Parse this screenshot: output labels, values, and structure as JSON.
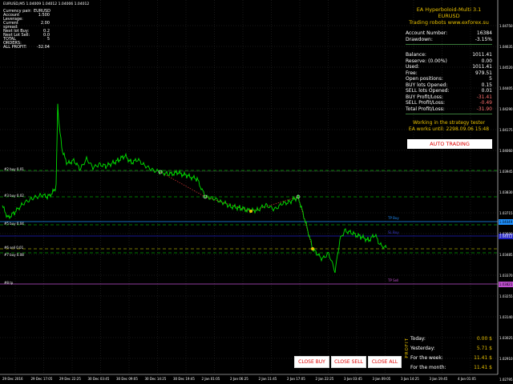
{
  "header": {
    "symbol": "EURUSD,M5",
    "ohlc": "1.04009 1.04012 1.04006 1.04012"
  },
  "info": [
    {
      "label": "Currency pair",
      "value": "EURUSD"
    },
    {
      "label": "Account Leverage",
      "value": "1:500"
    },
    {
      "label": "Current spread",
      "value": "2.00"
    },
    {
      "label": "Next lot Buy",
      "value": "0.2"
    },
    {
      "label": "Next Lot Sell",
      "value": "0.0"
    },
    {
      "label": "TOTAL ORDERS",
      "value": "5"
    },
    {
      "label": "ALL PROFIT",
      "value": "-32.04"
    }
  ],
  "panel": {
    "ea_title": "EA Hyperboloid-Multi 3.1 EURUSD",
    "ea_site": "Trading robots www.exforex.su",
    "account_number_label": "Account Number:",
    "account_number": "16384",
    "drawdown_label": "Drawdown:",
    "drawdown": "-3.15%",
    "balance_label": "Balance:",
    "balance": "1011.41",
    "reserve_label": "Reserve: (0.00%)",
    "reserve": "0.00",
    "used_label": "Used:",
    "used": "1011.41",
    "free_label": "Free:",
    "free": "979.51",
    "open_positions_label": "Open positions:",
    "open_positions": "5",
    "buy_lots_label": "BUY lots Opened:",
    "buy_lots": "0.15",
    "sell_lots_label": "SELL lots Opened:",
    "sell_lots": "0.01",
    "buy_pl_label": "BUY Profit/Loss:",
    "buy_pl": "-31.41",
    "sell_pl_label": "SELL Profit/Loss:",
    "sell_pl": "-0.49",
    "total_pl_label": "Total Profit/Loss:",
    "total_pl": "-31.90",
    "status_1": "Working in the strategy tester",
    "status_2": "EA works until: 2298.09.06 15:48"
  },
  "buttons": {
    "auto_trading": "AUTO TRADING",
    "close_buy": "CLOSE BUY",
    "close_sell": "CLOSE SELL",
    "close_all": "CLOSE ALL"
  },
  "profit": {
    "vertical_label": "PROFIT",
    "today_label": "Today:",
    "today": "0.00 $",
    "yesterday_label": "Yesterday:",
    "yesterday": "5.71 $",
    "week_label": "For the week:",
    "week": "11.41 $",
    "month_label": "For the month:",
    "month": "11.41 $"
  },
  "line_labels": {
    "buy2": "#2 buy 0.01",
    "buy3": "#3 buy 0.02",
    "buy5": "#5 buy 0.04",
    "sell6": "#6 sell 0.01",
    "buy7": "#7 buy 0.08",
    "tp": "#8 tp",
    "tp_buy": "TP Buy",
    "sl_buy": "SL Buy",
    "tp_sell": "TP Sell"
  },
  "price_tags": {
    "tp_buy": "1.04049",
    "bid": "1.04012",
    "tp_sell": "1.03821"
  },
  "price_axis": [
    "1.04750",
    "1.04635",
    "1.04520",
    "1.04405",
    "1.04290",
    "1.04175",
    "1.04060",
    "1.03945",
    "1.03830",
    "1.03715",
    "1.03600",
    "1.03485",
    "1.03370",
    "1.03255",
    "1.03140",
    "1.03025",
    "1.02910",
    "1.02795"
  ],
  "time_axis": [
    "29 Dec 2016",
    "29 Dec 17:05",
    "29 Dec 22:25",
    "30 Dec 03:45",
    "30 Dec 09:05",
    "30 Dec 14:25",
    "30 Dec 19:45",
    "2 Jan 01:05",
    "2 Jan 06:25",
    "2 Jan 11:45",
    "2 Jan 17:05",
    "2 Jan 22:25",
    "3 Jan 03:45",
    "3 Jan 09:05",
    "3 Jan 14:25",
    "3 Jan 19:45",
    "4 Jan 01:05"
  ],
  "colors": {
    "price_line": "#00e000",
    "tp_buy_line": "#1e90ff",
    "sl_buy_line": "#2020c0",
    "tp_sell_line": "#c050d0",
    "order_line": "#00a000",
    "accent_red": "#e00000",
    "accent_yellow": "#e8c000"
  }
}
